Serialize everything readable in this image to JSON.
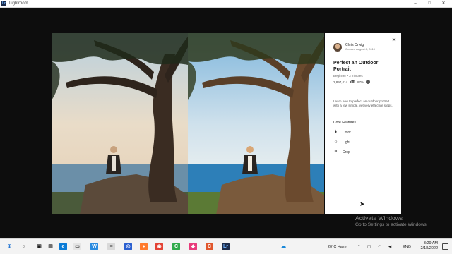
{
  "window": {
    "title": "Lightroom",
    "logo": "Lr",
    "controls": [
      "–",
      "□",
      "✕"
    ]
  },
  "panel": {
    "close_label": "✕",
    "author": {
      "name": "Chris Orwig",
      "date": "Created August 8, 2019"
    },
    "title": "Perfect an Outdoor Portrait",
    "meta": "Beginner • 3 minutes",
    "views": "2,897,414",
    "rating": "87%",
    "description": "Learn how to perfect an outdoor portrait with a few simple, yet very effective steps.",
    "features_heading": "Core Features",
    "features": [
      {
        "label": "Color",
        "icon": "color-drop-icon",
        "glyph": "🌢"
      },
      {
        "label": "Light",
        "icon": "sun-icon",
        "glyph": "☼"
      },
      {
        "label": "Crop",
        "icon": "crop-icon",
        "glyph": "⌗"
      }
    ]
  },
  "watermark": {
    "title": "Activate Windows",
    "subtitle": "Go to Settings to activate Windows."
  },
  "taskbar": {
    "weather": "20°C  Haze",
    "language": "ENG",
    "time": "3:29 AM",
    "date": "2/18/2022"
  }
}
